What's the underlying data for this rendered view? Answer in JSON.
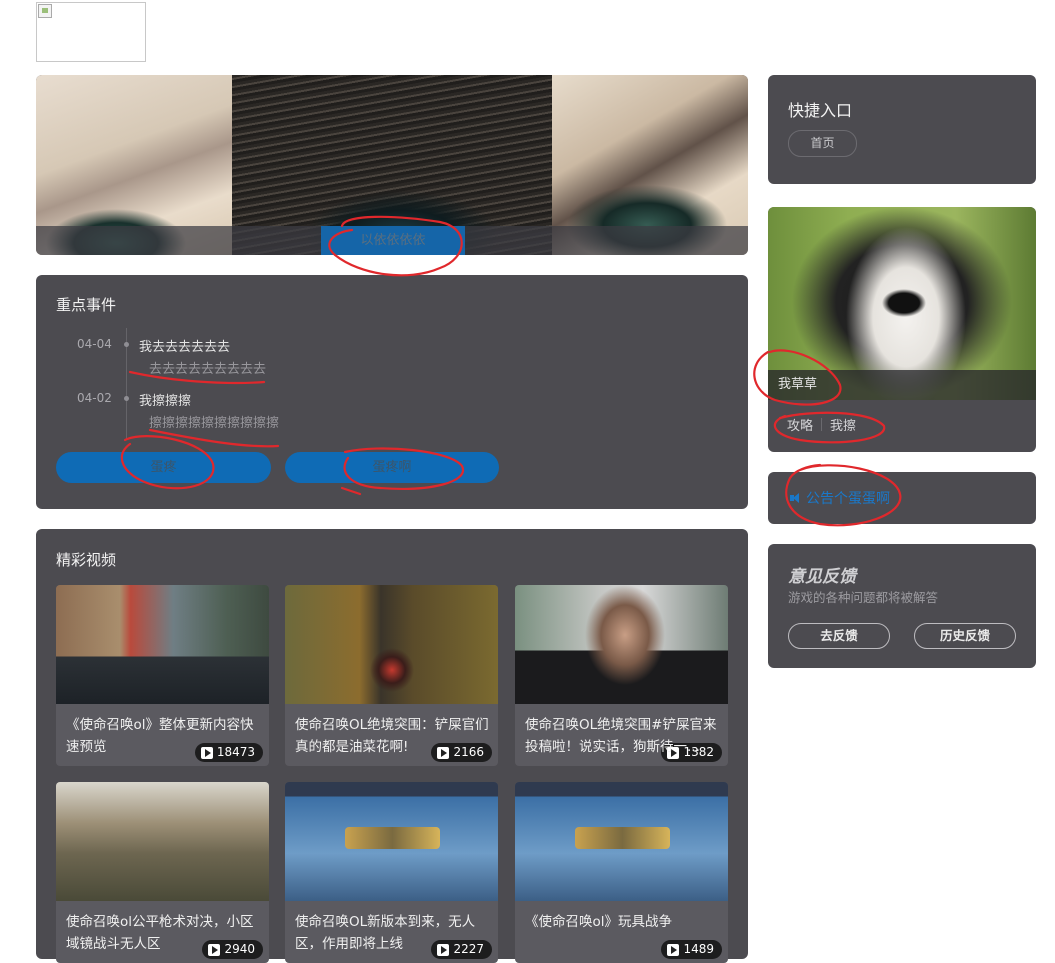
{
  "banner": {
    "caption": "以依依依依"
  },
  "events": {
    "title": "重点事件",
    "items": [
      {
        "date": "04-04",
        "title": "我去去去去去去",
        "detail": "去去去去去去去去去"
      },
      {
        "date": "04-02",
        "title": "我擦擦擦",
        "detail": "擦擦擦擦擦擦擦擦擦擦"
      }
    ],
    "buttons": [
      "蛋疼",
      "蛋疼啊"
    ]
  },
  "videos": {
    "title": "精彩视频",
    "items": [
      {
        "count": "18473",
        "title": "《使命召唤ol》整体更新内容快速预览"
      },
      {
        "count": "2166",
        "title": "使命召唤OL绝境突围：铲屎官们真的都是油菜花啊!"
      },
      {
        "count": "1382",
        "title": "使命召唤OL绝境突围#铲屎官来投稿啦！说实话，狗斯待一..."
      },
      {
        "count": "2940",
        "title": "使命召唤ol公平枪术对决，小区域镜战斗无人区"
      },
      {
        "count": "2227",
        "title": "使命召唤OL新版本到来，无人区，作用即将上线"
      },
      {
        "count": "1489",
        "title": "《使命召唤ol》玩具战争"
      }
    ]
  },
  "quick_entry": {
    "title": "快捷入口",
    "links": [
      "首页"
    ]
  },
  "dog_card": {
    "caption": "我草草",
    "links": [
      "攻略",
      "我擦"
    ]
  },
  "notice": {
    "text": "公告个蛋蛋啊",
    "icon": "speaker-icon"
  },
  "feedback": {
    "title": "意见反馈",
    "subtitle": "游戏的各种问题都将被解答",
    "buttons": [
      "去反馈",
      "历史反馈"
    ]
  },
  "colors": {
    "card_bg": "#4c4b50",
    "accent_blue": "#0f6bb5",
    "annotation_red": "#e0282c"
  }
}
